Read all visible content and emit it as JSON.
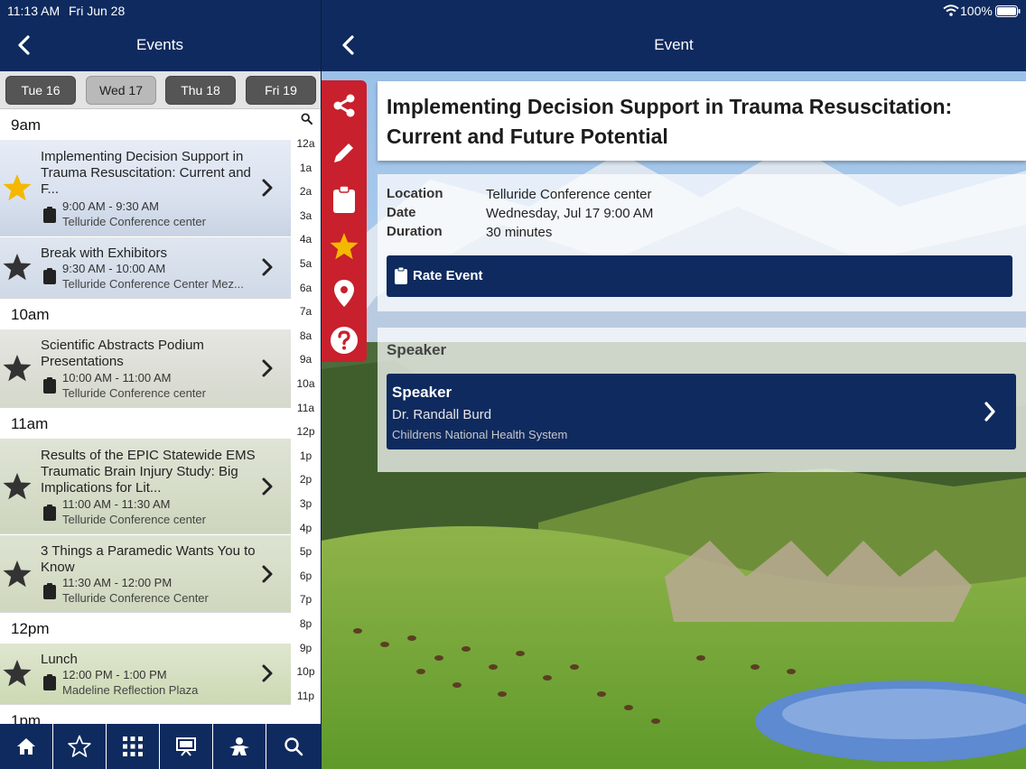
{
  "status_bar": {
    "time": "11:13 AM",
    "date": "Fri Jun 28",
    "battery": "100%"
  },
  "left": {
    "title": "Events",
    "days": [
      {
        "label": "Tue 16",
        "selected": false
      },
      {
        "label": "Wed 17",
        "selected": true
      },
      {
        "label": "Thu 18",
        "selected": false
      },
      {
        "label": "Fri 19",
        "selected": false
      }
    ],
    "hours": {
      "h9": "9am",
      "h10": "10am",
      "h11": "11am",
      "h12": "12pm",
      "h13": "1pm"
    },
    "events": [
      {
        "title": "Implementing Decision Support in Trauma Resuscitation: Current and F...",
        "time": "9:00 AM - 9:30 AM",
        "location": "Telluride Conference center",
        "starred": true
      },
      {
        "title": "Break with Exhibitors",
        "time": "9:30 AM - 10:00 AM",
        "location": "Telluride Conference Center Mez...",
        "starred": false
      },
      {
        "title": "Scientific Abstracts Podium Presentations",
        "time": "10:00 AM - 11:00 AM",
        "location": "Telluride Conference center",
        "starred": false
      },
      {
        "title": "Results of the EPIC Statewide EMS Traumatic Brain Injury Study: Big Implications for Lit...",
        "time": "11:00 AM - 11:30 AM",
        "location": "Telluride Conference center",
        "starred": false
      },
      {
        "title": "3 Things a Paramedic Wants You to Know",
        "time": "11:30 AM - 12:00 PM",
        "location": "Telluride Conference Center",
        "starred": false
      },
      {
        "title": "Lunch",
        "time": "12:00 PM - 1:00 PM",
        "location": "Madeline Reflection Plaza",
        "starred": false
      }
    ],
    "hour_index": [
      "12a",
      "1a",
      "2a",
      "3a",
      "4a",
      "5a",
      "6a",
      "7a",
      "8a",
      "9a",
      "10a",
      "11a",
      "12p",
      "1p",
      "2p",
      "3p",
      "4p",
      "5p",
      "6p",
      "7p",
      "8p",
      "9p",
      "10p",
      "11p"
    ],
    "tabs": [
      "home-icon",
      "star-icon",
      "grid-icon",
      "presentation-icon",
      "sponsor-icon",
      "search-icon"
    ]
  },
  "detail": {
    "nav_title": "Event",
    "title": "Implementing Decision Support in Trauma Resuscitation: Current and Future Potential",
    "labels": {
      "location": "Location",
      "date": "Date",
      "duration": "Duration"
    },
    "values": {
      "location": "Telluride Conference center",
      "date": "Wednesday, Jul 17 9:00 AM",
      "duration": "30 minutes"
    },
    "rate_button": "Rate Event",
    "speaker_header": "Speaker",
    "speaker": {
      "role": "Speaker",
      "name": "Dr. Randall Burd",
      "org": "Childrens National Health System"
    },
    "actions": [
      "share-icon",
      "pencil-icon",
      "clipboard-icon",
      "star-icon",
      "map-pin-icon",
      "help-icon"
    ]
  },
  "colors": {
    "nav": "#0f2a5e",
    "action_bar": "#c8202c",
    "star_active": "#f5b800"
  }
}
